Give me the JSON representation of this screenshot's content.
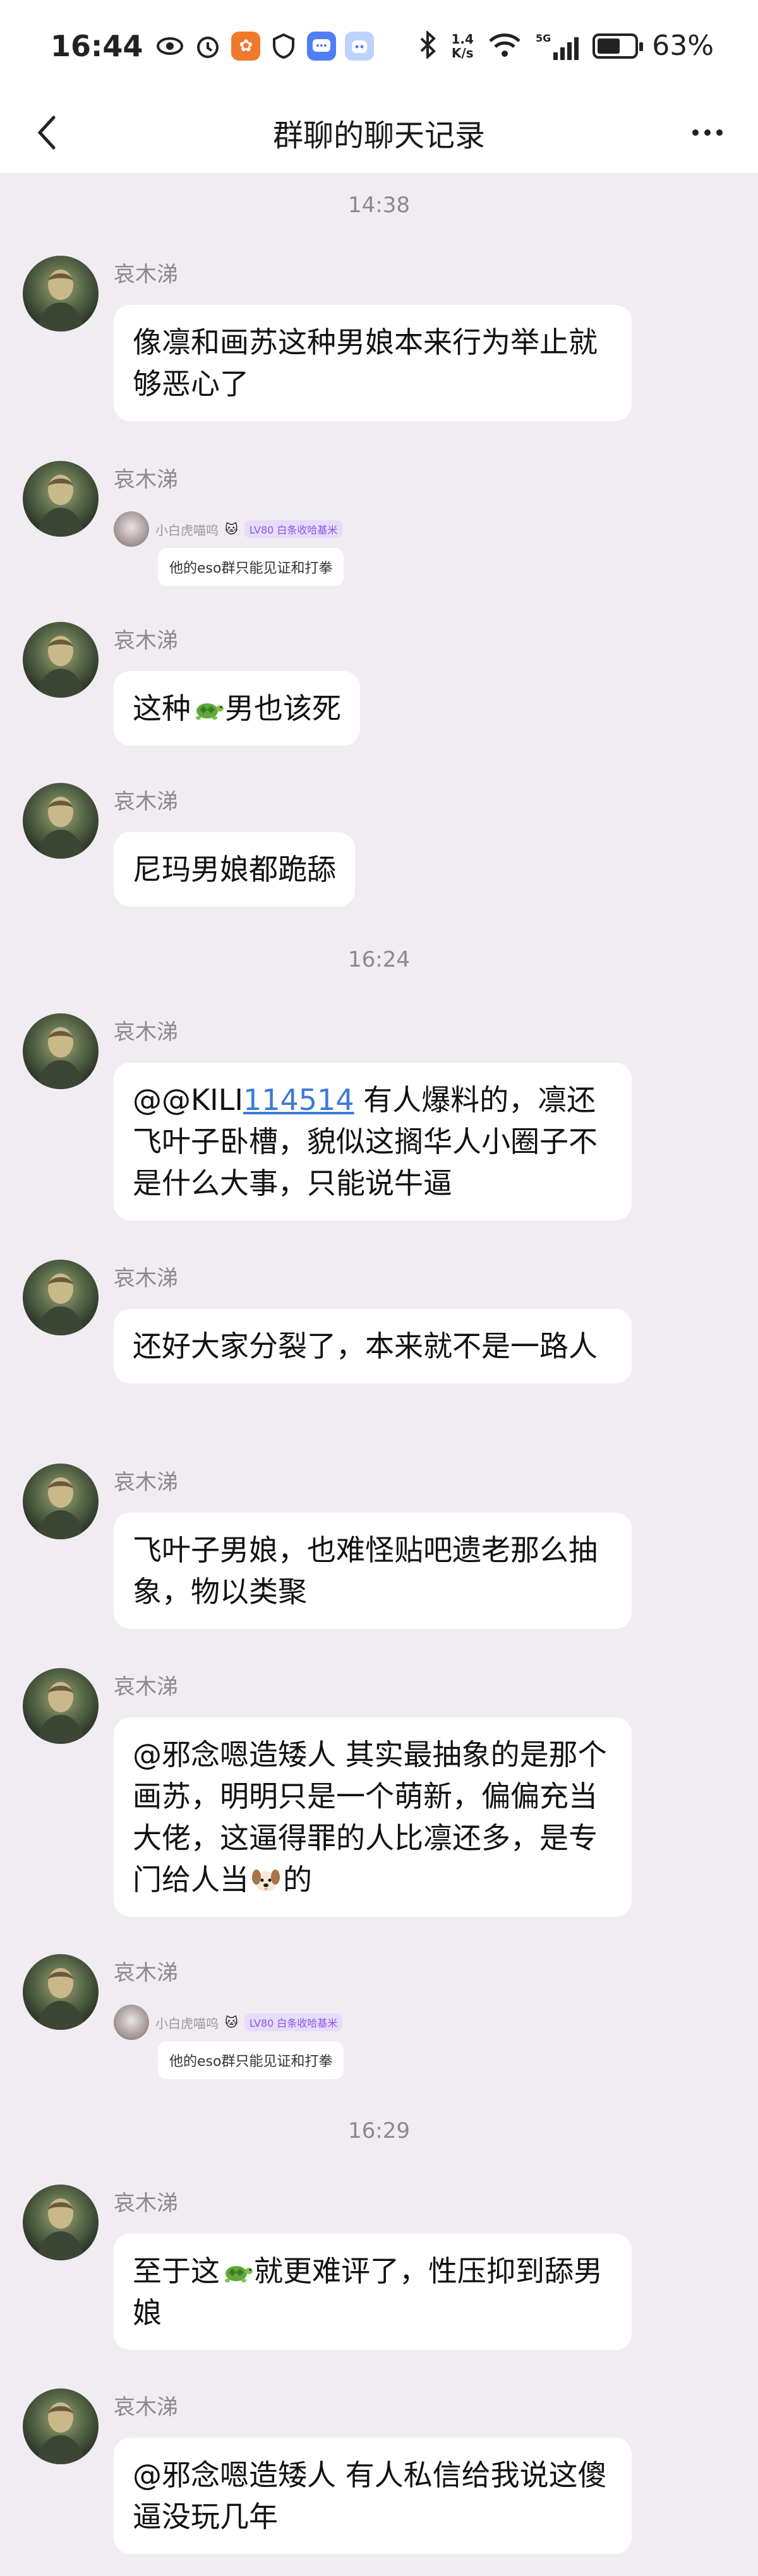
{
  "status": {
    "time": "16:44",
    "net_speed_value": "1.4",
    "net_speed_unit": "K/s",
    "battery": "63%",
    "battery_level": 0.63,
    "signal_label": "5G"
  },
  "nav": {
    "title": "群聊的聊天记录"
  },
  "timestamps": [
    "14:38",
    "16:24",
    "16:29"
  ],
  "sender": "哀木涕",
  "messages": [
    {
      "text": "像凛和画苏这种男娘本来行为举止就够恶心了"
    },
    {
      "reply_name": "小白虎喵呜",
      "reply_badge": "LV80 白条收哈基米",
      "reply_text": "他的eso群只能见证和打拳"
    },
    {
      "pre": "这种",
      "post": "男也该死"
    },
    {
      "text": "尼玛男娘都跪舔"
    },
    {
      "pre": "@@KILI",
      "link": "114514",
      "post": " 有人爆料的，凛还飞叶子卧槽，貌似这搁华人小圈子不是什么大事，只能说牛逼"
    },
    {
      "text": "还好大家分裂了，本来就不是一路人"
    },
    {
      "text": "飞叶子男娘，也难怪贴吧遗老那么抽象，物以类聚"
    },
    {
      "pre": "@邪念嗯造矮人 其实最抽象的是那个画苏，明明只是一个萌新，偏偏充当大佬，这逼得罪的人比凛还多，是专门给人当",
      "post": "的"
    },
    {
      "reply_name": "小白虎喵呜",
      "reply_badge": "LV80 白条收哈基米",
      "reply_text": "他的eso群只能见证和打拳"
    },
    {
      "pre": "至于这",
      "post": "就更难评了，性压抑到舔男娘"
    },
    {
      "text": "@邪念嗯造矮人 有人私信给我说这傻逼没玩几年"
    }
  ]
}
